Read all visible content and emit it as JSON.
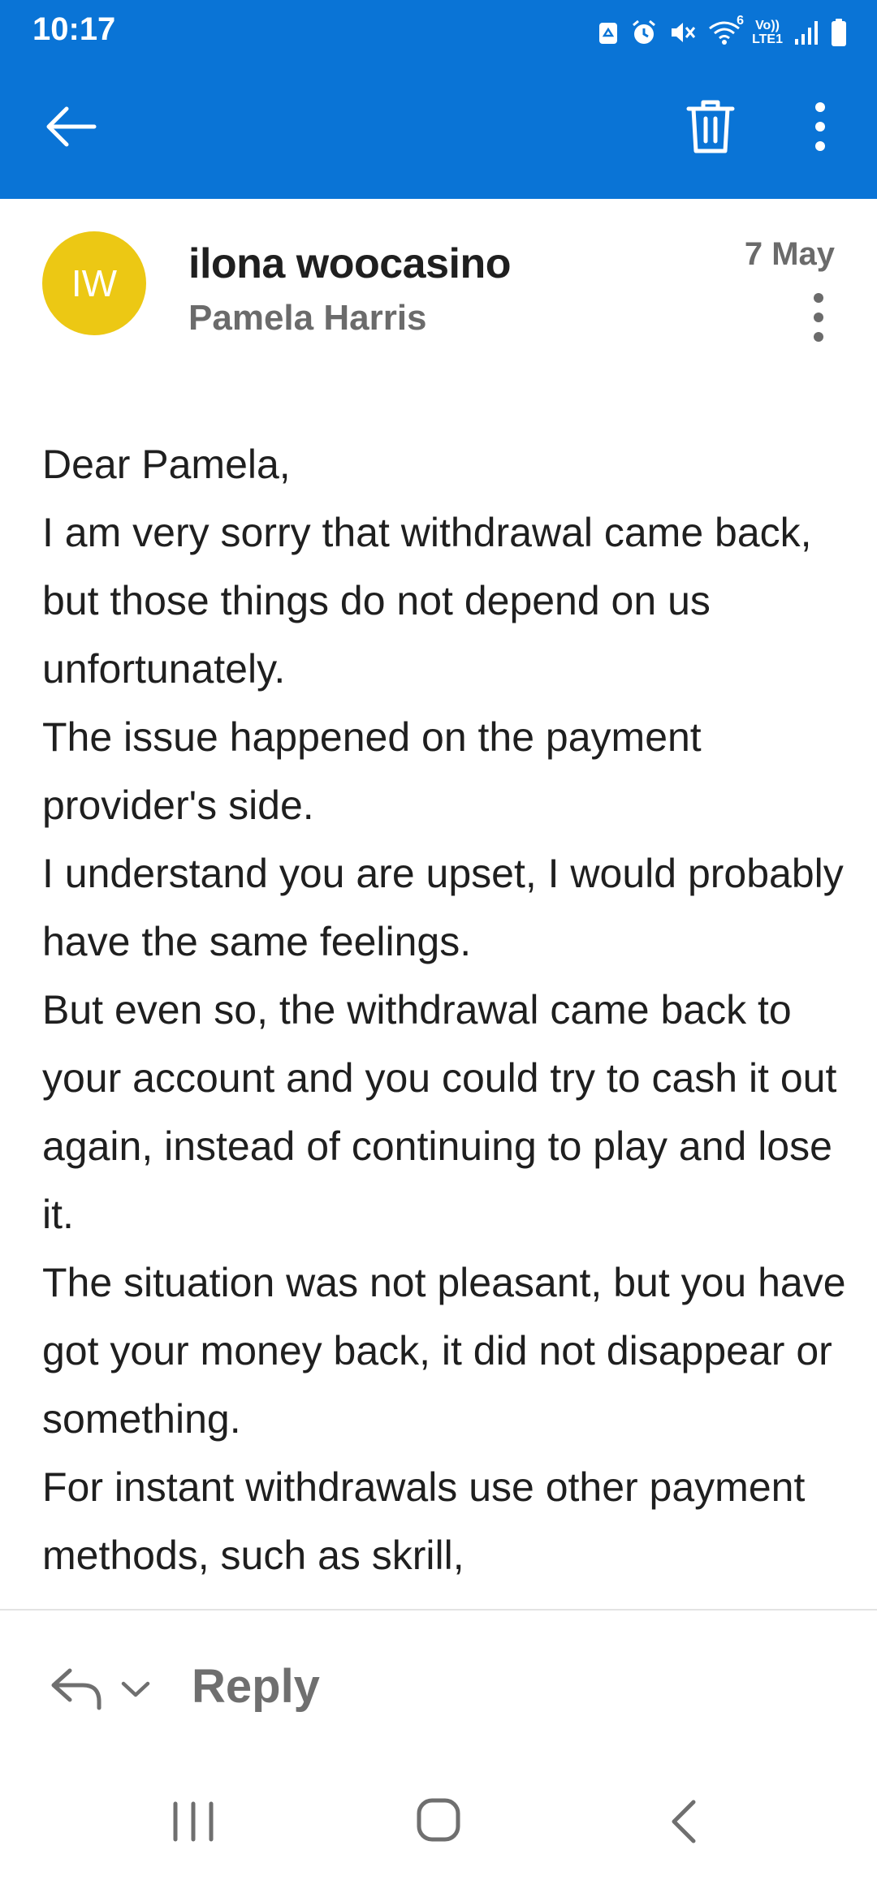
{
  "status_bar": {
    "time": "10:17",
    "icons": [
      "recycle-icon",
      "alarm-icon",
      "mute-icon",
      "wifi-icon",
      "volte-icon",
      "signal-icon",
      "battery-icon"
    ],
    "volte_top": "Vo))",
    "volte_bottom": "LTE1",
    "wifi_badge": "6"
  },
  "app_bar": {
    "background": "#0a74d6",
    "icons": [
      "back-arrow-icon",
      "trash-icon",
      "more-vertical-icon"
    ]
  },
  "message": {
    "avatar_initials": "IW",
    "avatar_color": "#ecc814",
    "sender": "ilona woocasino",
    "recipient": "Pamela Harris",
    "date": "7 May",
    "body": [
      "Dear Pamela,",
      "I am very sorry that withdrawal came back,  but those things do not depend on us unfortunately.",
      "The issue happened on the payment provider's side.",
      "I understand you are upset, I would probably have the same feelings.",
      "But even so, the withdrawal came back to your account and you could try to cash it out again, instead of continuing to play and lose it.",
      "The situation was not pleasant, but you have got your money back, it did not disappear or something.",
      "For instant withdrawals use other payment methods, such as skrill,"
    ]
  },
  "reply_bar": {
    "label": "Reply",
    "icons": [
      "reply-icon",
      "chevron-down-icon"
    ]
  },
  "nav_bar": {
    "icons": [
      "recents-icon",
      "home-icon",
      "back-icon"
    ]
  }
}
